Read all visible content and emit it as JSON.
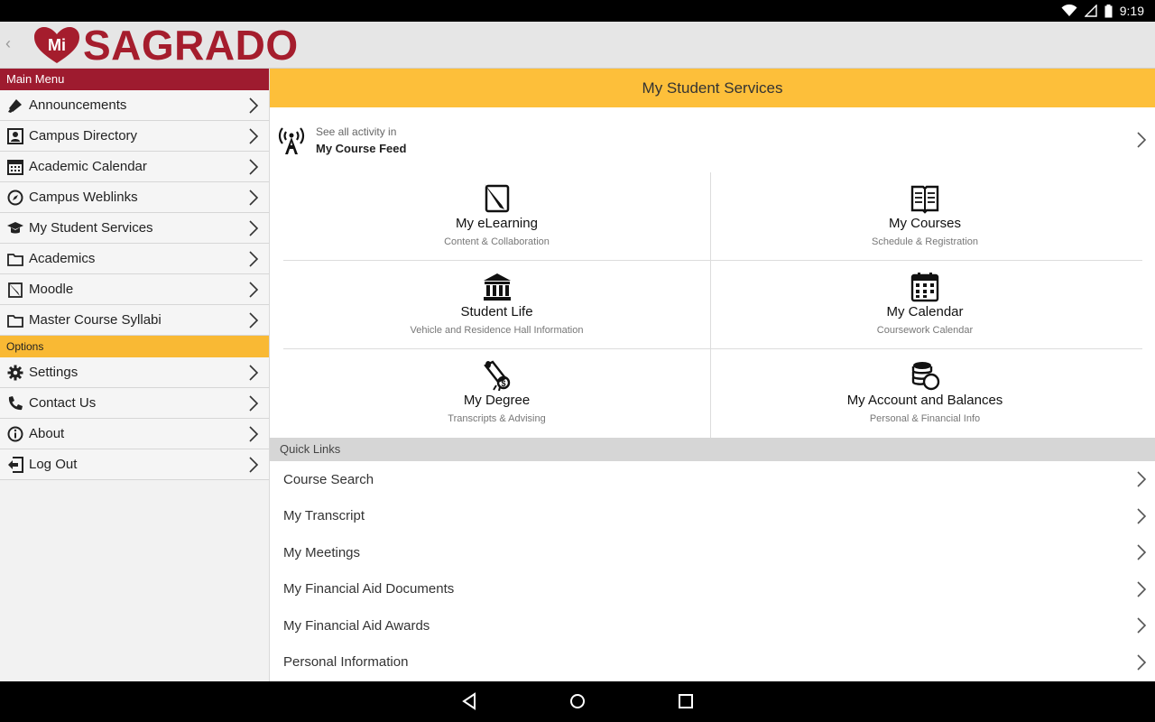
{
  "status_bar": {
    "time": "9:19"
  },
  "header": {
    "logo_text": "SAGRADO",
    "logo_mark": "Mi"
  },
  "sidebar": {
    "main_menu_label": "Main Menu",
    "options_label": "Options",
    "main_items": [
      {
        "label": "Announcements",
        "icon": "megaphone-icon"
      },
      {
        "label": "Campus Directory",
        "icon": "contact-card-icon"
      },
      {
        "label": "Academic Calendar",
        "icon": "calendar-icon"
      },
      {
        "label": "Campus Weblinks",
        "icon": "compass-icon"
      },
      {
        "label": "My Student Services",
        "icon": "graduation-cap-icon"
      },
      {
        "label": "Academics",
        "icon": "folder-icon"
      },
      {
        "label": "Moodle",
        "icon": "pencil-note-icon"
      },
      {
        "label": "Master Course Syllabi",
        "icon": "folder-icon"
      }
    ],
    "option_items": [
      {
        "label": "Settings",
        "icon": "gear-icon"
      },
      {
        "label": "Contact Us",
        "icon": "phone-icon"
      },
      {
        "label": "About",
        "icon": "info-icon"
      },
      {
        "label": "Log Out",
        "icon": "logout-icon"
      }
    ]
  },
  "main": {
    "title": "My Student Services",
    "feed": {
      "small": "See all activity in",
      "big": "My Course Feed"
    },
    "tiles": [
      {
        "title": "My eLearning",
        "subtitle": "Content & Collaboration",
        "icon": "pencil-paper-icon"
      },
      {
        "title": "My Courses",
        "subtitle": "Schedule & Registration",
        "icon": "open-book-icon"
      },
      {
        "title": "Student Life",
        "subtitle": "Vehicle and Residence Hall Information",
        "icon": "building-columns-icon"
      },
      {
        "title": "My Calendar",
        "subtitle": "Coursework Calendar",
        "icon": "calendar-grid-icon"
      },
      {
        "title": "My Degree",
        "subtitle": "Transcripts & Advising",
        "icon": "diploma-icon"
      },
      {
        "title": "My Account and Balances",
        "subtitle": "Personal & Financial Info",
        "icon": "coins-icon"
      }
    ],
    "quick_links_label": "Quick Links",
    "quick_links": [
      "Course Search",
      "My Transcript",
      "My Meetings",
      "My Financial Aid Documents",
      "My Financial Aid Awards",
      "Personal Information"
    ]
  },
  "colors": {
    "brand_red": "#9e1b2f",
    "brand_yellow": "#fdbf3a",
    "logo_red": "#a51d2d"
  }
}
